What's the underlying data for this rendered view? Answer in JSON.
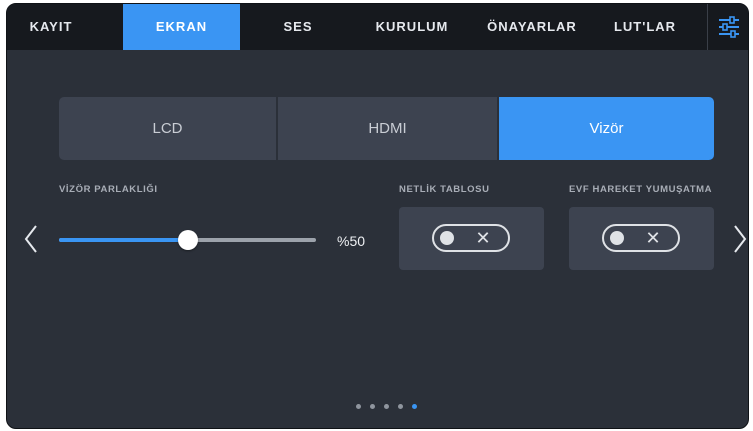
{
  "tabs": [
    {
      "label": "KAYIT"
    },
    {
      "label": "EKRAN"
    },
    {
      "label": "SES"
    },
    {
      "label": "KURULUM"
    },
    {
      "label": "ÖNAYARLAR"
    },
    {
      "label": "LUT'LAR"
    }
  ],
  "active_tab": "EKRAN",
  "outputs": [
    {
      "label": "LCD"
    },
    {
      "label": "HDMI"
    },
    {
      "label": "Vizör"
    }
  ],
  "active_output": "Vizör",
  "brightness": {
    "label": "VİZÖR PARLAKLIĞI",
    "value_text": "%50",
    "level_fraction": 0.5
  },
  "focus_chart": {
    "label": "NETLİK TABLOSU",
    "state": "off"
  },
  "evf_motion": {
    "label": "EVF HAREKET YUMUŞATMA",
    "state": "off"
  },
  "pagination": {
    "pages": 5,
    "current": 5
  },
  "icons": {
    "settings": "sliders-icon",
    "prev": "chevron-left-icon",
    "next": "chevron-right-icon",
    "toggle_off": "x-icon"
  },
  "colors": {
    "accent": "#3a95f3",
    "background": "#2b3039",
    "tab_bar": "#16191e",
    "panel": "#3d4350"
  }
}
